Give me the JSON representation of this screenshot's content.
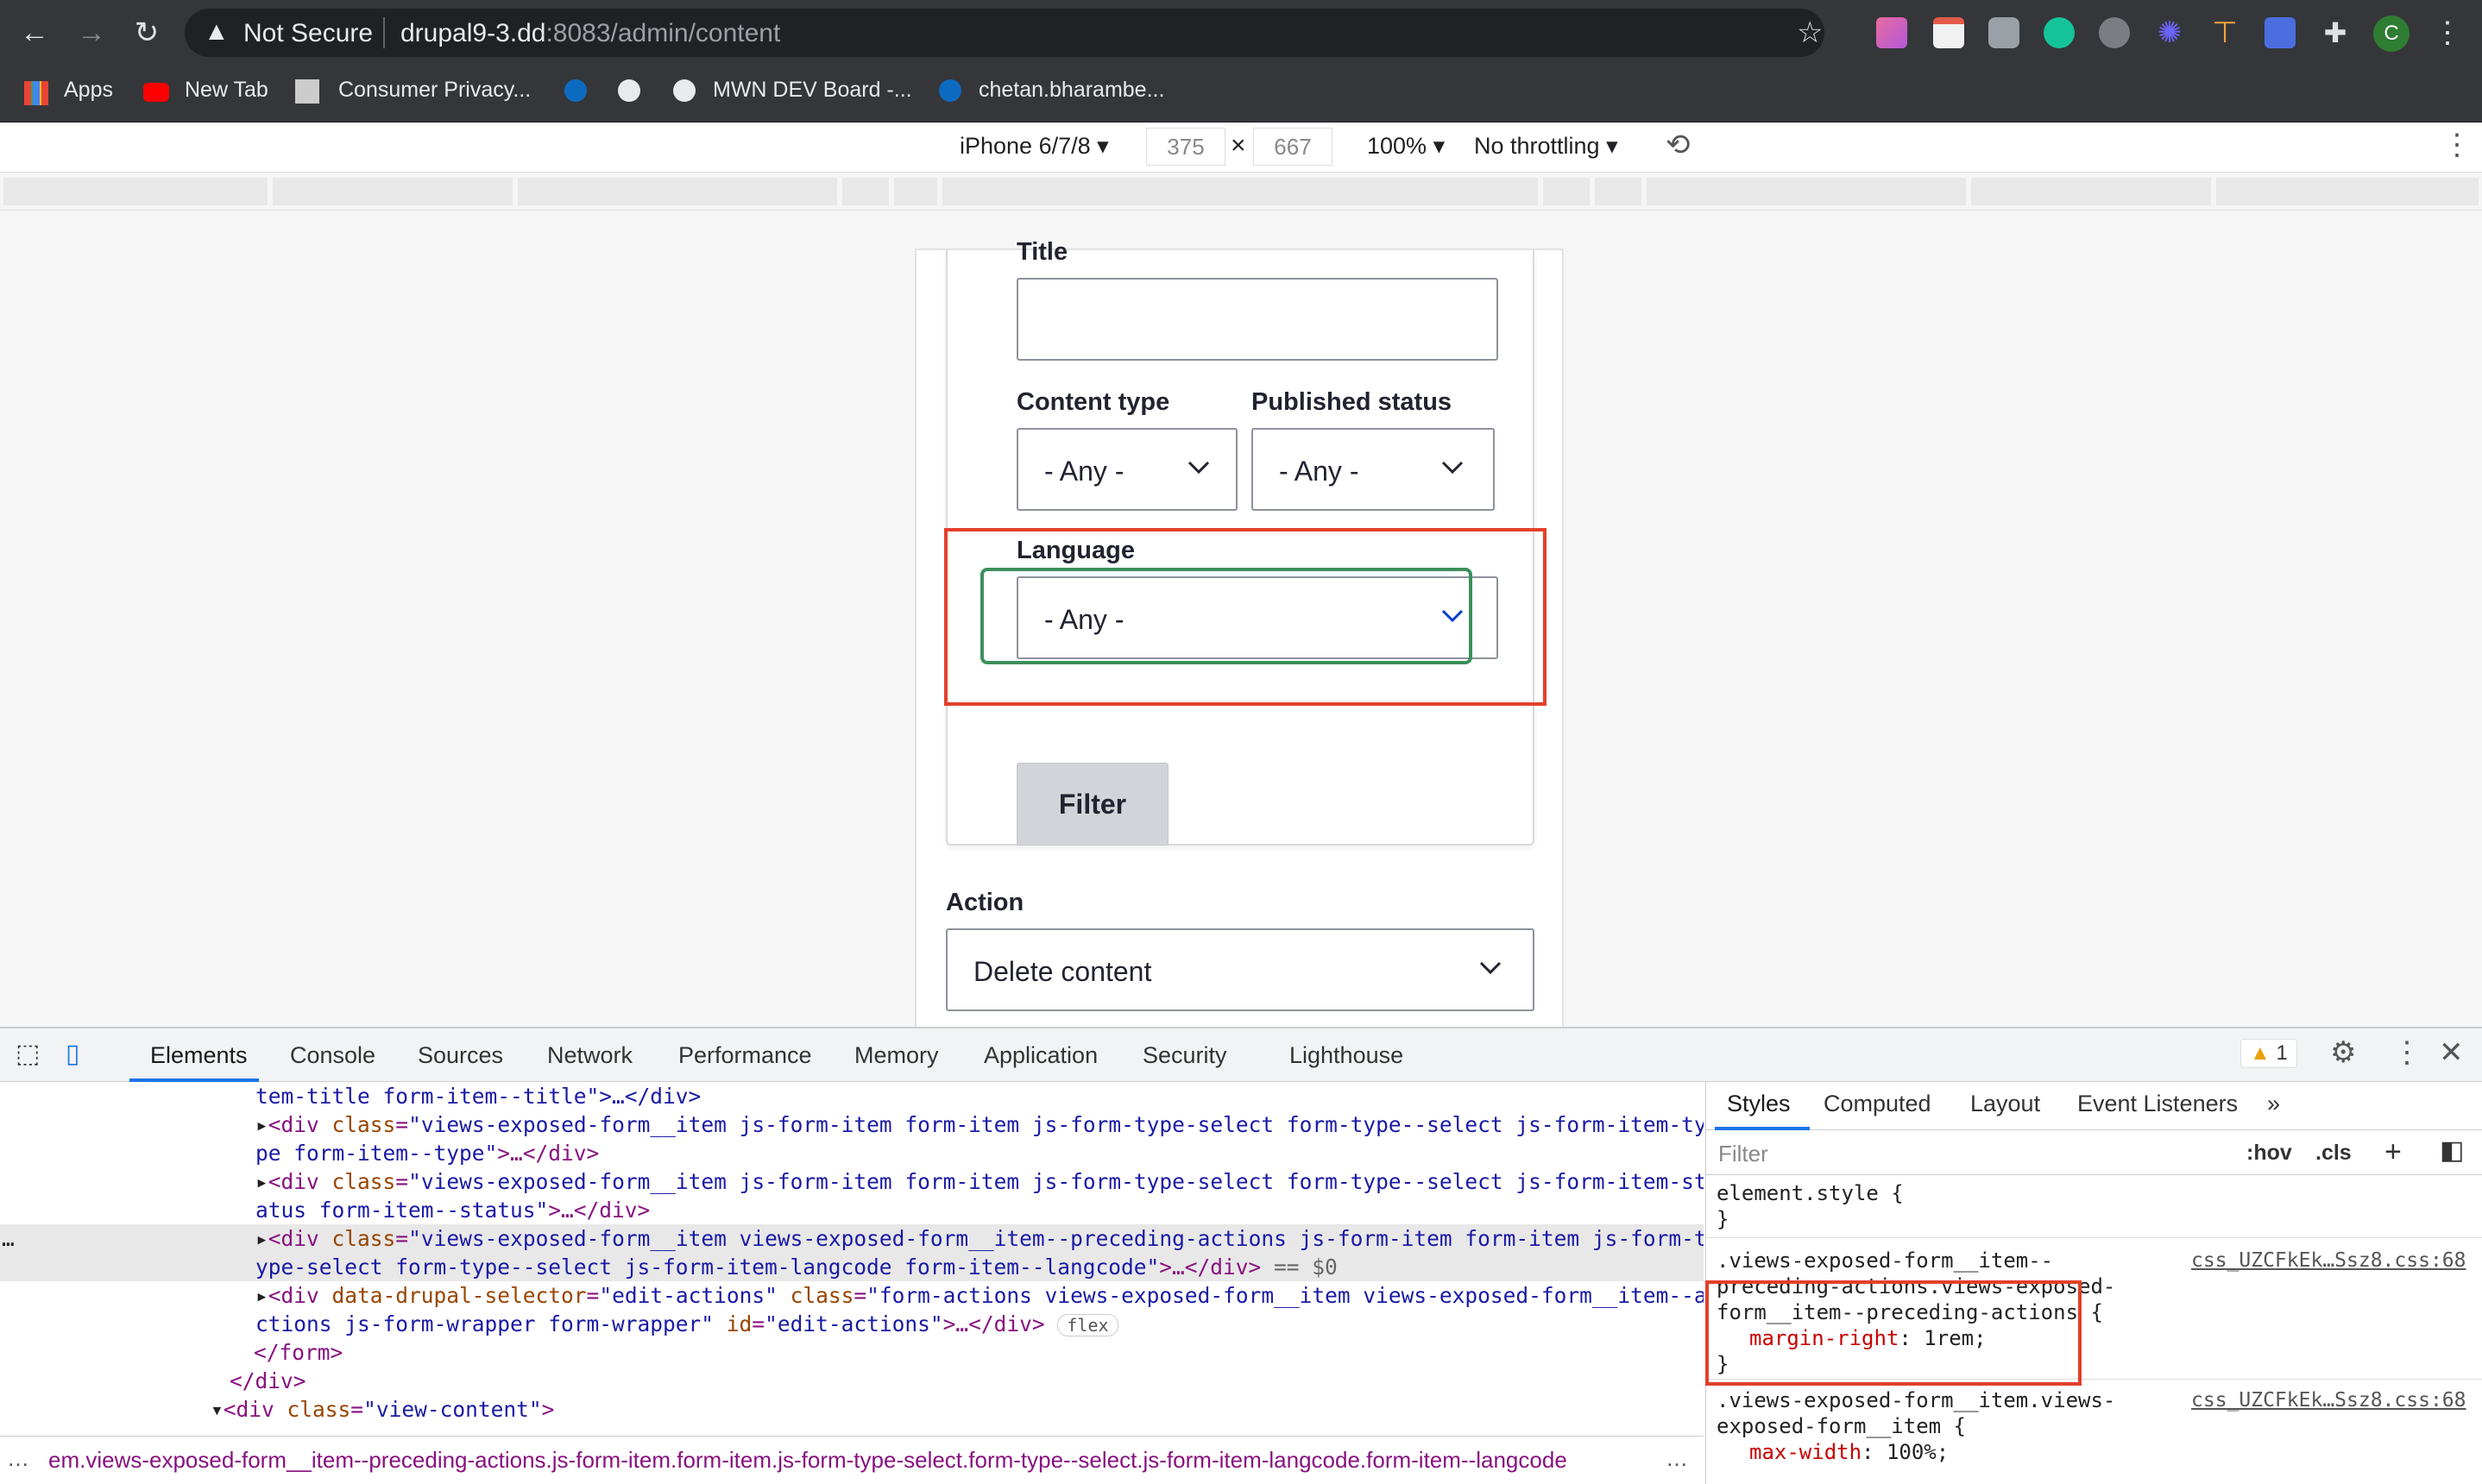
{
  "browser": {
    "not_secure": "Not Secure",
    "url_host": "drupal9-3.dd",
    "url_rest": ":8083/admin/content",
    "profile_initial": "C"
  },
  "bookmarks": [
    {
      "label": "Apps"
    },
    {
      "label": "New Tab"
    },
    {
      "label": "Consumer Privacy..."
    },
    {
      "label": "MWN DEV Board -..."
    },
    {
      "label": "chetan.bharambe..."
    }
  ],
  "device_toolbar": {
    "device": "iPhone 6/7/8",
    "width": "375",
    "times": "×",
    "height": "667",
    "zoom": "100%",
    "throttle": "No throttling"
  },
  "form": {
    "title_label": "Title",
    "content_type_label": "Content type",
    "content_type_value": "- Any -",
    "published_label": "Published status",
    "published_value": "- Any -",
    "language_label": "Language",
    "language_value": "- Any -",
    "filter_button": "Filter",
    "action_label": "Action",
    "action_value": "Delete content"
  },
  "devtools": {
    "tabs": [
      "Elements",
      "Console",
      "Sources",
      "Network",
      "Performance",
      "Memory",
      "Application",
      "Security",
      "Lighthouse"
    ],
    "warning_count": "1",
    "dom_lines": {
      "l1_text": "tem-title form-item--title\">…</div>",
      "l2_open": "<div ",
      "l2_attr": "class",
      "l2_val": "\"views-exposed-form__item js-form-item form-item js-form-type-select form-type--select js-form-item-ty",
      "l3_val": "pe form-item--type\"",
      "l3_tail": ">…</div>",
      "l4_val": "\"views-exposed-form__item js-form-item form-item js-form-type-select form-type--select js-form-item-st",
      "l5_val": "atus form-item--status\"",
      "l5_tail": ">…</div>",
      "l6_val": "\"views-exposed-form__item views-exposed-form__item--preceding-actions js-form-item form-item js-form-t",
      "l7_val": "ype-select form-type--select js-form-item-langcode form-item--langcode\"",
      "l7_tail": ">…</div>",
      "l7_eq": " == $0",
      "l8_attr1": "data-drupal-selector",
      "l8_val1": "\"edit-actions\"",
      "l8_attr2": "class",
      "l8_val2": "\"form-actions views-exposed-form__item views-exposed-form__item--a",
      "l9_val": "ctions js-form-wrapper form-wrapper\"",
      "l9_attr": "id",
      "l9_val2": "\"edit-actions\"",
      "l9_tail": ">…</div>",
      "l9_badge": "flex",
      "l10": "</form>",
      "l11": "</div>",
      "l12_open": "<div ",
      "l12_attr": "class",
      "l12_val": "\"view-content\"",
      "l12_close": ">"
    },
    "breadcrumb": "em.views-exposed-form__item--preceding-actions.js-form-item.form-item.js-form-type-select.form-type--select.js-form-item-langcode.form-item--langcode",
    "styles_tabs": [
      "Styles",
      "Computed",
      "Layout",
      "Event Listeners"
    ],
    "styles_filter_placeholder": "Filter",
    "hov": ":hov",
    "cls": ".cls",
    "rules": {
      "r0_sel": "element.style {",
      "r0_end": "}",
      "r1_sel1": ".views-exposed-form__item--",
      "r1_sel2": "preceding-actions.views-exposed-",
      "r1_sel3": "form__item--preceding-actions {",
      "r1_prop": "margin-right",
      "r1_val": ": 1rem;",
      "r1_end": "}",
      "r1_src": "css_UZCFkEk…Ssz8.css:68",
      "r2_sel1": ".views-exposed-form__item.views-",
      "r2_sel2": "exposed-form__item {",
      "r2_prop": "max-width",
      "r2_val": ": 100%;",
      "r2_src": "css_UZCFkEk…Ssz8.css:68"
    }
  }
}
